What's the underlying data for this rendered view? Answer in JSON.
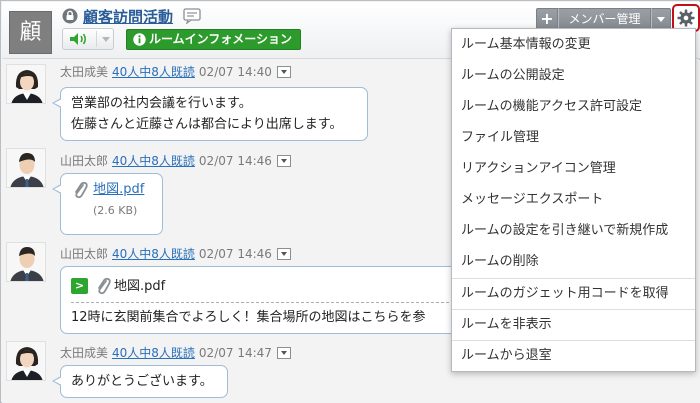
{
  "room": {
    "avatar_char": "顧",
    "title": "顧客訪問活動",
    "info_button": "ルームインフォメーション",
    "member_button": "メンバー管理",
    "plus_label": "+"
  },
  "messages": [
    {
      "author": "太田成美",
      "read": "40人中8人既読",
      "time": "02/07 14:40",
      "lines": [
        "営業部の社内会議を行います。",
        "佐藤さんと近藤さんは都合により出席します。"
      ]
    },
    {
      "author": "山田太郎",
      "read": "40人中8人既読",
      "time": "02/07 14:46",
      "file_name": "地図.pdf",
      "file_size": "(2.6 KB)"
    },
    {
      "author": "山田太郎",
      "read": "40人中8人既読",
      "time": "02/07 14:46",
      "quote_badge": ">",
      "file_name": "地図.pdf",
      "text": "12時に玄関前集合でよろしく！集合場所の地図はこちらを参"
    },
    {
      "author": "太田成美",
      "read": "40人中8人既読",
      "time": "02/07 14:47",
      "text": "ありがとうございます。"
    }
  ],
  "menu": {
    "items": [
      "ルーム基本情報の変更",
      "ルームの公開設定",
      "ルームの機能アクセス許可設定",
      "ファイル管理",
      "リアクションアイコン管理",
      "メッセージエクスポート",
      "ルームの設定を引き継いで新規作成",
      "ルームの削除",
      "ルームのガジェット用コードを取得",
      "ルームを非表示",
      "ルームから退室"
    ]
  },
  "colors": {
    "title_link": "#2a5d98",
    "info_button": "#2c9b2c",
    "gear_highlight": "#c0101a",
    "bubble_border": "#9fbdd7"
  }
}
